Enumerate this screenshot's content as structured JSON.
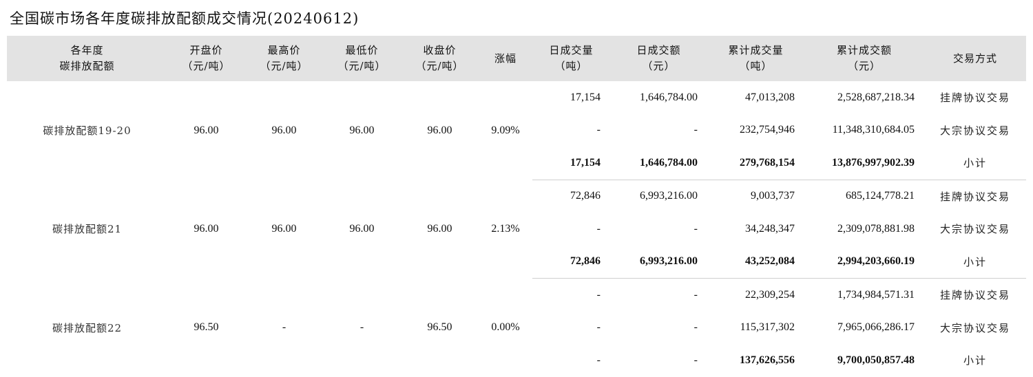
{
  "title": "全国碳市场各年度碳排放配额成交情况(20240612)",
  "headers": [
    {
      "l1": "各年度",
      "l2": "碳排放配额"
    },
    {
      "l1": "开盘价",
      "l2": "（元/吨）"
    },
    {
      "l1": "最高价",
      "l2": "（元/吨）"
    },
    {
      "l1": "最低价",
      "l2": "（元/吨）"
    },
    {
      "l1": "收盘价",
      "l2": "（元/吨）"
    },
    {
      "l1": "涨幅",
      "l2": ""
    },
    {
      "l1": "日成交量",
      "l2": "（吨）"
    },
    {
      "l1": "日成交额",
      "l2": "（元）"
    },
    {
      "l1": "累计成交量",
      "l2": "（吨）"
    },
    {
      "l1": "累计成交额",
      "l2": "（元）"
    },
    {
      "l1": "交易方式",
      "l2": ""
    }
  ],
  "groups": [
    {
      "name": "碳排放配额19-20",
      "open": "96.00",
      "high": "96.00",
      "low": "96.00",
      "close": "96.00",
      "change": "9.09%",
      "rows": [
        {
          "daily_vol": "17,154",
          "daily_amt": "1,646,784.00",
          "cum_vol": "47,013,208",
          "cum_amt": "2,528,687,218.34",
          "method": "挂牌协议交易"
        },
        {
          "daily_vol": "-",
          "daily_amt": "-",
          "cum_vol": "232,754,946",
          "cum_amt": "11,348,310,684.05",
          "method": "大宗协议交易"
        },
        {
          "daily_vol": "17,154",
          "daily_amt": "1,646,784.00",
          "cum_vol": "279,768,154",
          "cum_amt": "13,876,997,902.39",
          "method": "小计"
        }
      ]
    },
    {
      "name": "碳排放配额21",
      "open": "96.00",
      "high": "96.00",
      "low": "96.00",
      "close": "96.00",
      "change": "2.13%",
      "rows": [
        {
          "daily_vol": "72,846",
          "daily_amt": "6,993,216.00",
          "cum_vol": "9,003,737",
          "cum_amt": "685,124,778.21",
          "method": "挂牌协议交易"
        },
        {
          "daily_vol": "-",
          "daily_amt": "-",
          "cum_vol": "34,248,347",
          "cum_amt": "2,309,078,881.98",
          "method": "大宗协议交易"
        },
        {
          "daily_vol": "72,846",
          "daily_amt": "6,993,216.00",
          "cum_vol": "43,252,084",
          "cum_amt": "2,994,203,660.19",
          "method": "小计"
        }
      ]
    },
    {
      "name": "碳排放配额22",
      "open": "96.50",
      "high": "-",
      "low": "-",
      "close": "96.50",
      "change": "0.00%",
      "rows": [
        {
          "daily_vol": "-",
          "daily_amt": "-",
          "cum_vol": "22,309,254",
          "cum_amt": "1,734,984,571.31",
          "method": "挂牌协议交易"
        },
        {
          "daily_vol": "-",
          "daily_amt": "-",
          "cum_vol": "115,317,302",
          "cum_amt": "7,965,066,286.17",
          "method": "大宗协议交易"
        },
        {
          "daily_vol": "-",
          "daily_amt": "-",
          "cum_vol": "137,626,556",
          "cum_amt": "9,700,050,857.48",
          "method": "小计"
        }
      ]
    }
  ]
}
